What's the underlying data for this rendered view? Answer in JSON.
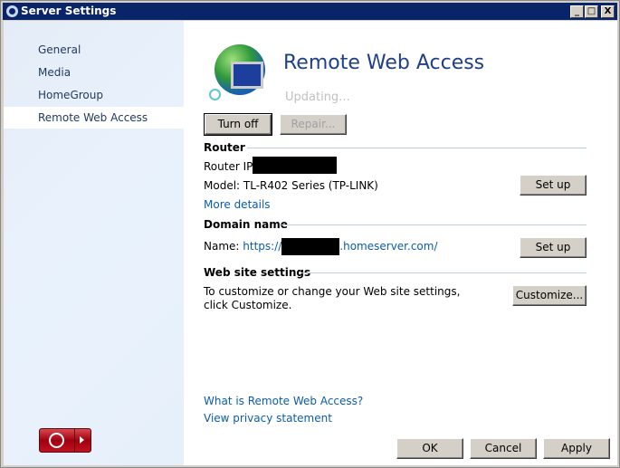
{
  "window": {
    "title": "Server Settings"
  },
  "sidebar": {
    "items": [
      {
        "label": "General"
      },
      {
        "label": "Media"
      },
      {
        "label": "HomeGroup"
      },
      {
        "label": "Remote Web Access",
        "selected": true
      }
    ]
  },
  "main": {
    "title": "Remote Web Access",
    "status": "Updating...",
    "turn_off": "Turn off",
    "repair": "Repair...",
    "router": {
      "heading": "Router",
      "ip_label": "Router IP:",
      "model": "Model: TL-R402 Series (TP-LINK)",
      "more_details": "More details",
      "setup": "Set up"
    },
    "domain": {
      "heading": "Domain name",
      "name_label": "Name:",
      "url_prefix": "https://",
      "url_suffix": ".homeserver.com/",
      "setup": "Set up"
    },
    "website": {
      "heading": "Web site settings",
      "desc": "To customize or change your Web site settings, click Customize.",
      "customize": "Customize..."
    },
    "links": {
      "what_is": "What is Remote Web Access?",
      "privacy": "View privacy statement"
    }
  },
  "footer": {
    "ok": "OK",
    "cancel": "Cancel",
    "apply": "Apply"
  },
  "colors": {
    "titlebar": "#0a246a",
    "title_text": "#1e3f8a",
    "link": "#0b5cad",
    "power_button": "#b0101a"
  }
}
